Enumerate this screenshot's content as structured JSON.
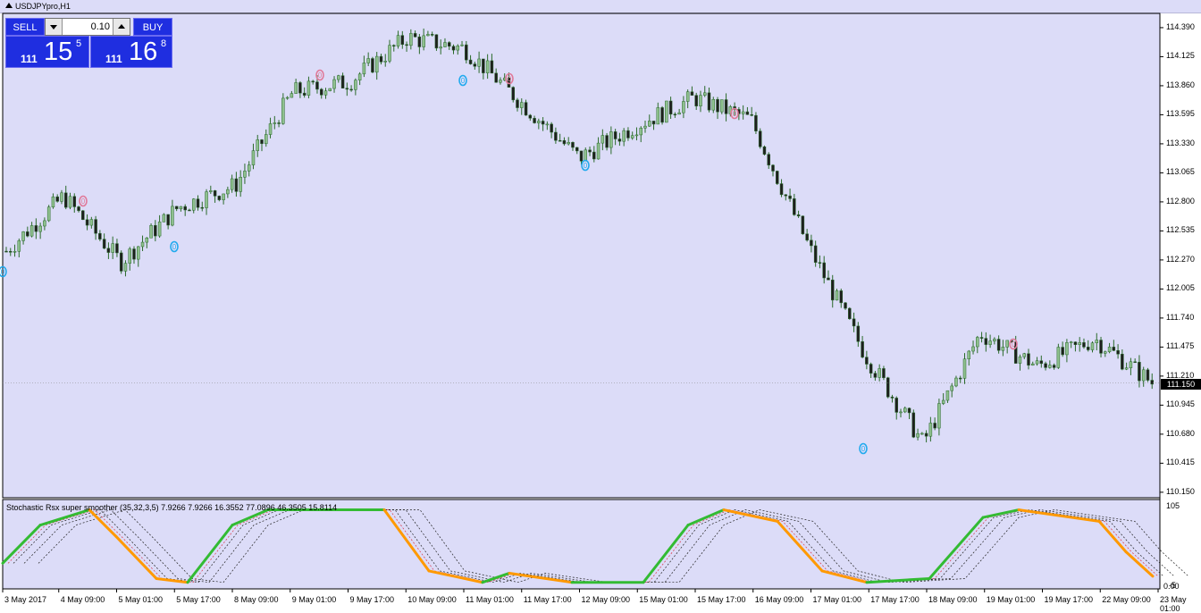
{
  "window": {
    "title": "USDJPYpro,H1"
  },
  "trade_panel": {
    "sell_label": "SELL",
    "buy_label": "BUY",
    "lot": "0.10",
    "bid_small": "111",
    "bid_big": "15",
    "bid_sup": "5",
    "ask_small": "111",
    "ask_big": "16",
    "ask_sup": "8"
  },
  "price_axis": [
    "114.390",
    "114.125",
    "113.860",
    "113.595",
    "113.330",
    "113.065",
    "112.800",
    "112.535",
    "112.270",
    "112.005",
    "111.740",
    "111.475",
    "111.210",
    "110.945",
    "110.680",
    "110.415",
    "110.150"
  ],
  "current_price": "111.150",
  "indicator": {
    "label": "Stochastic Rsx super smoother (35,32,3,5) 7.9266 7.9266 16.3552 77.0896 46.3505 15.8114",
    "max_label": "105",
    "min_label": "-5",
    "zero_label": "0.00"
  },
  "time_axis": [
    "3 May 2017",
    "4 May 09:00",
    "5 May 01:00",
    "5 May 17:00",
    "8 May 09:00",
    "9 May 01:00",
    "9 May 17:00",
    "10 May 09:00",
    "11 May 01:00",
    "11 May 17:00",
    "12 May 09:00",
    "15 May 01:00",
    "15 May 17:00",
    "16 May 09:00",
    "17 May 01:00",
    "17 May 17:00",
    "18 May 09:00",
    "19 May 01:00",
    "19 May 17:00",
    "22 May 09:00",
    "23 May 01:00"
  ],
  "markers": {
    "text": "0"
  },
  "colors": {
    "background": "#dcdcf8",
    "bull_candle": "#8fc08f",
    "bear_candle": "#1e1e1e",
    "wick": "#2a6a2a",
    "green_line": "#33bb33",
    "orange_line": "#ff9900",
    "marker_blue": "#22aaee",
    "marker_pink": "#e07a9a",
    "button_blue": "#1f2ee0"
  },
  "chart_data": {
    "type": "candlestick",
    "title": "USDJPYpro,H1",
    "ylim": [
      110.1,
      114.52
    ],
    "x": [
      "3 May 2017",
      "4 May 09:00",
      "5 May 01:00",
      "5 May 17:00",
      "8 May 09:00",
      "9 May 01:00",
      "9 May 17:00",
      "10 May 09:00",
      "11 May 01:00",
      "11 May 17:00",
      "12 May 09:00",
      "15 May 01:00",
      "15 May 17:00",
      "16 May 09:00",
      "17 May 01:00",
      "17 May 17:00",
      "18 May 09:00",
      "19 May 01:00",
      "19 May 17:00",
      "22 May 09:00",
      "23 May 01:00"
    ],
    "series": [
      {
        "values": [
          112.35,
          112.85,
          112.25,
          112.75,
          112.95,
          113.8,
          113.9,
          114.3,
          114.2,
          113.7,
          113.2,
          113.5,
          113.75,
          113.55,
          112.4,
          111.4,
          110.6,
          111.6,
          111.3,
          111.55,
          111.15
        ]
      }
    ]
  }
}
